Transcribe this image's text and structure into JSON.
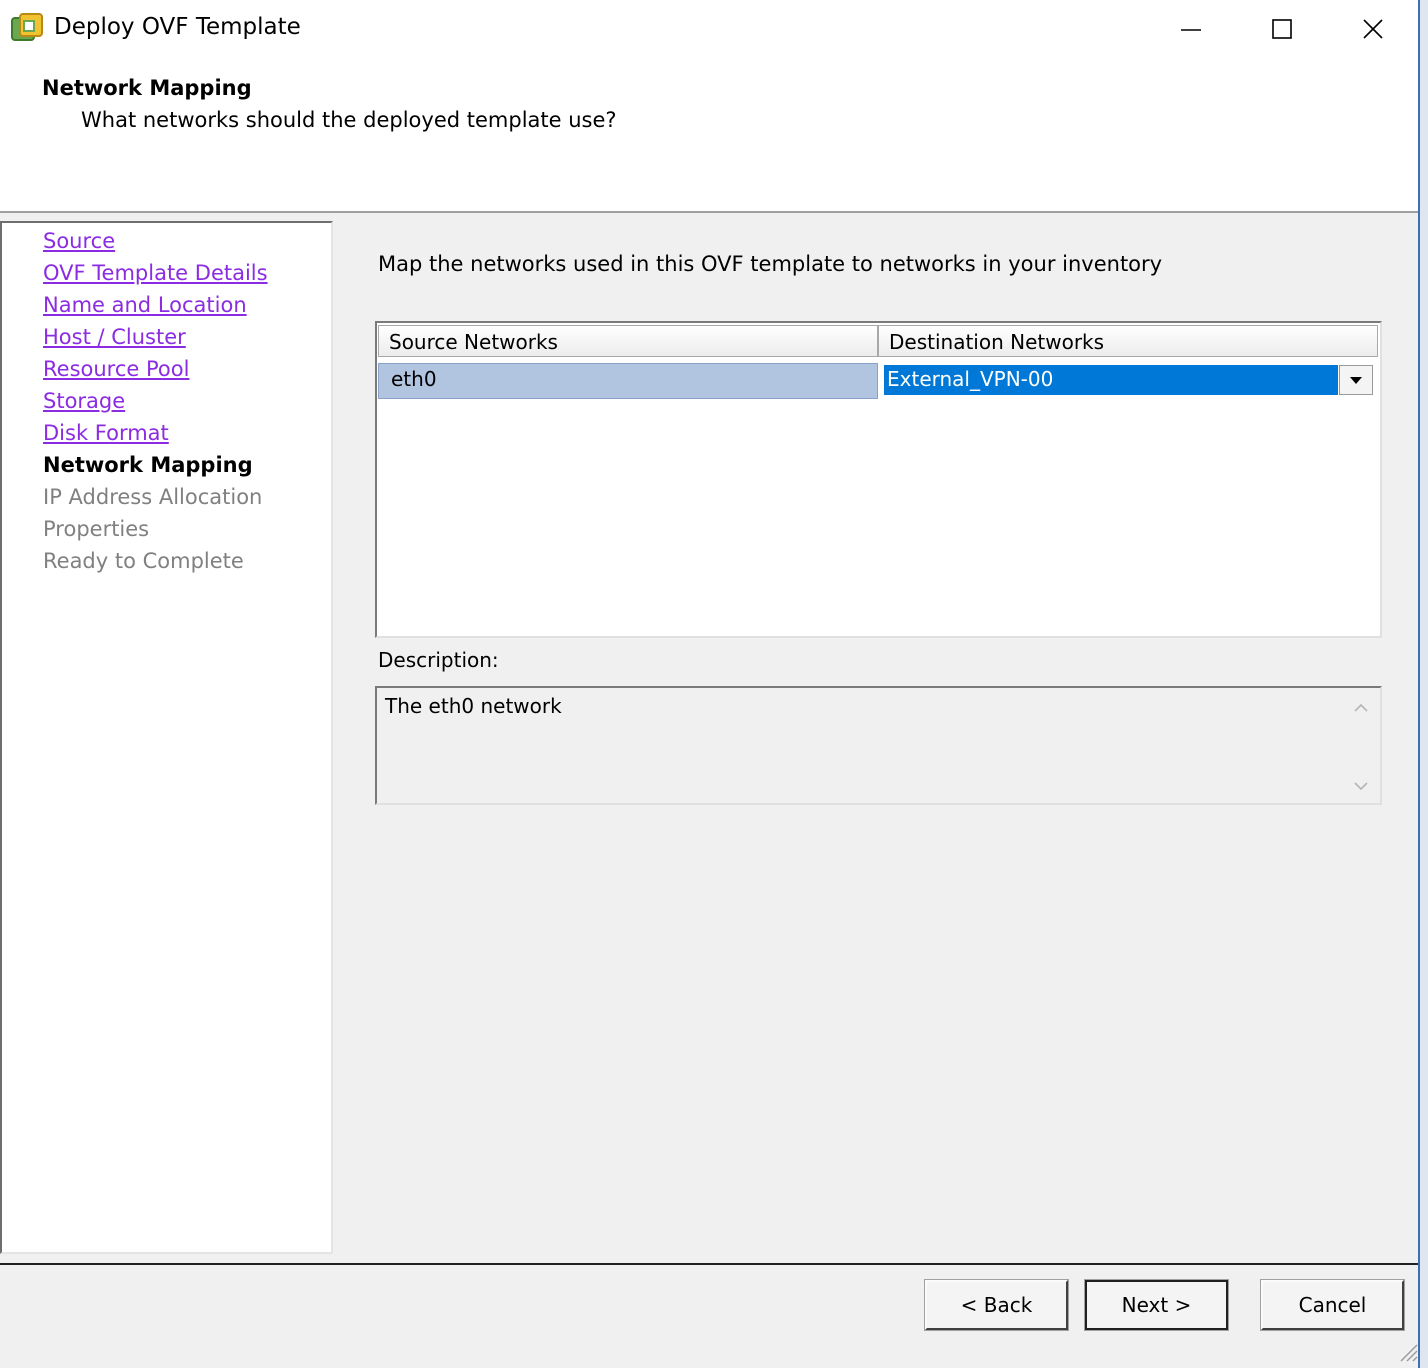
{
  "window": {
    "title": "Deploy OVF Template",
    "icon": "vsphere-app-icon",
    "controls": [
      "minimize-icon",
      "maximize-icon",
      "close-icon"
    ]
  },
  "header": {
    "title": "Network Mapping",
    "subtitle": "What networks should the deployed template use?"
  },
  "steps": [
    {
      "label": "Source",
      "state": "done"
    },
    {
      "label": "OVF Template Details",
      "state": "done"
    },
    {
      "label": "Name and Location",
      "state": "done"
    },
    {
      "label": "Host / Cluster",
      "state": "done"
    },
    {
      "label": "Resource Pool",
      "state": "done"
    },
    {
      "label": "Storage",
      "state": "done"
    },
    {
      "label": "Disk Format",
      "state": "done"
    },
    {
      "label": "Network Mapping",
      "state": "current"
    },
    {
      "label": "IP Address Allocation",
      "state": "future"
    },
    {
      "label": "Properties",
      "state": "future"
    },
    {
      "label": "Ready to Complete",
      "state": "future"
    }
  ],
  "main": {
    "instruction": "Map the networks used in this OVF template to networks in your inventory",
    "table": {
      "columns": [
        "Source Networks",
        "Destination Networks"
      ],
      "rows": [
        {
          "source": "eth0",
          "destination": "External_VPN-00"
        }
      ]
    },
    "description_label": "Description:",
    "description_text": "The eth0 network"
  },
  "footer": {
    "back_label": "< Back",
    "next_label": "Next >",
    "cancel_label": "Cancel"
  },
  "colors": {
    "visited_link": "#8b2be2",
    "selection": "#0078d7",
    "row_highlight": "#b2c5e0",
    "panel_bg": "#f0f0f0"
  }
}
